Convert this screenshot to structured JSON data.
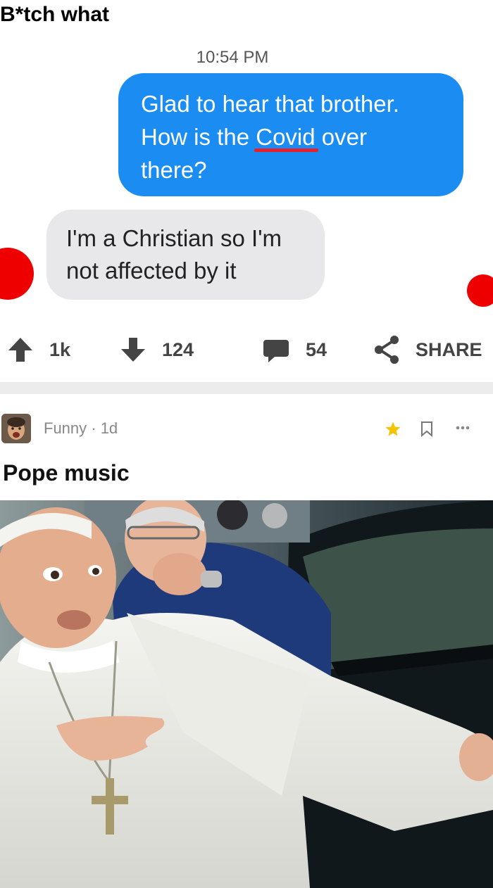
{
  "post1": {
    "title": "B*tch what",
    "chat": {
      "time": "10:54 PM",
      "outgoing": {
        "line1": "Glad to hear that brother.",
        "line2_before": "How is the ",
        "line2_word": "Covid",
        "line2_after": " over",
        "line3": "there?"
      },
      "incoming": {
        "line1": "I'm a Christian so I'm",
        "line2": "not affected by it"
      }
    },
    "actions": {
      "upvotes": "1k",
      "downvotes": "124",
      "comments": "54",
      "share_label": "SHARE"
    }
  },
  "post2": {
    "meta": "Funny · 1d",
    "title": "Pope music"
  },
  "colors": {
    "bubble_blue": "#1a8cf2",
    "bubble_gray": "#e8e8ea",
    "red_dot": "#ee0000",
    "star": "#f5c400"
  },
  "icons": [
    "upvote-arrow-icon",
    "downvote-arrow-icon",
    "comment-icon",
    "share-icon",
    "star-icon",
    "bookmark-icon",
    "more-icon"
  ]
}
